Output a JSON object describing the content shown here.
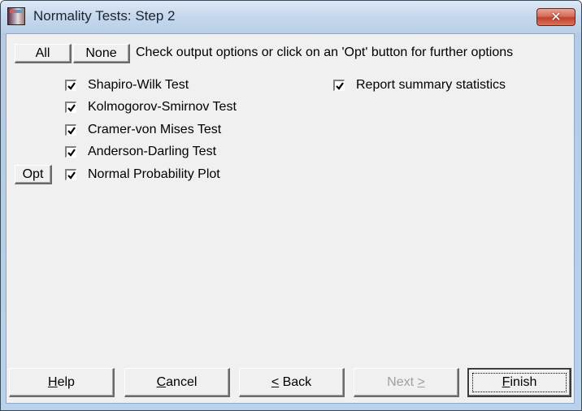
{
  "window": {
    "title": "Normality Tests: Step 2",
    "close_symbol": "✕"
  },
  "toolbar": {
    "all_label": "All",
    "none_label": "None",
    "hint": "Check output options or click on an 'Opt' button for further options"
  },
  "options": [
    {
      "label": "Shapiro-Wilk Test",
      "checked": true,
      "has_opt": false
    },
    {
      "label": "Kolmogorov-Smirnov Test",
      "checked": true,
      "has_opt": false
    },
    {
      "label": "Cramer-von Mises Test",
      "checked": true,
      "has_opt": false
    },
    {
      "label": "Anderson-Darling Test",
      "checked": true,
      "has_opt": false
    },
    {
      "label": "Normal Probability Plot",
      "checked": true,
      "has_opt": true
    }
  ],
  "opt_button_label": "Opt",
  "summary_option": {
    "label": "Report summary statistics",
    "checked": true
  },
  "footer": {
    "help": {
      "mnemonic": "H",
      "rest": "elp"
    },
    "cancel": {
      "mnemonic": "C",
      "rest": "ancel"
    },
    "back": {
      "mnemonic": "<",
      "rest": " Back"
    },
    "next": {
      "pre": "Next ",
      "mnemonic": ">",
      "disabled": true
    },
    "finish": {
      "mnemonic": "F",
      "rest": "inish",
      "default": true
    }
  }
}
